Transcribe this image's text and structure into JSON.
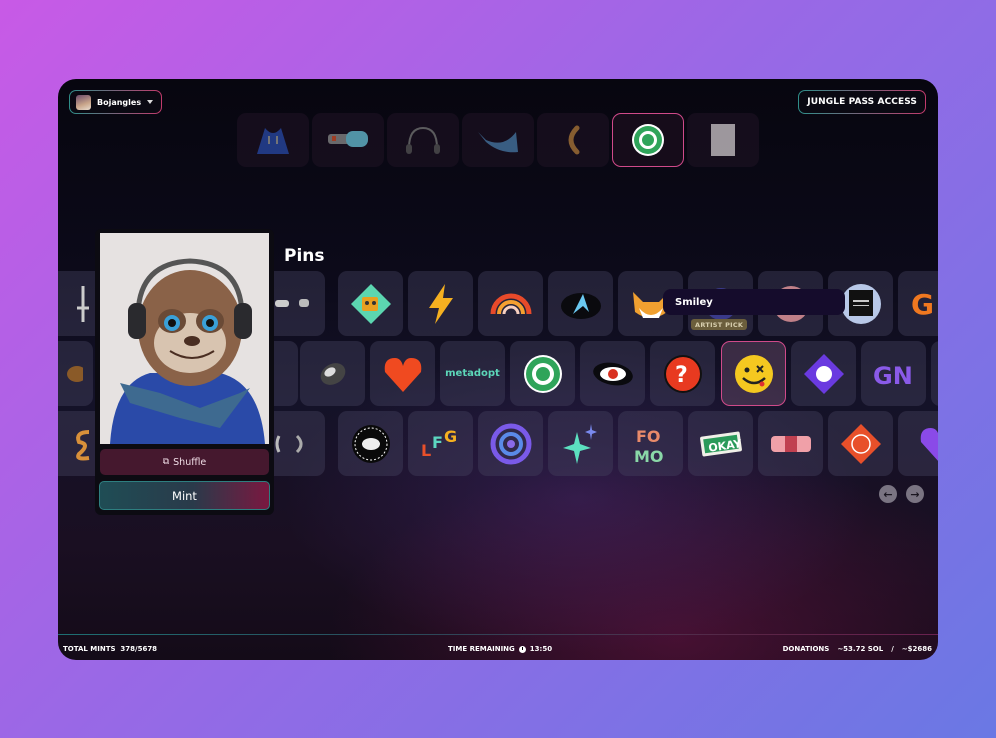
{
  "header": {
    "user_name": "Bojangles",
    "pass_button": "JUNGLE PASS ACCESS"
  },
  "traits": [
    {
      "name": "hoodie",
      "active": false
    },
    {
      "name": "goggles",
      "active": false
    },
    {
      "name": "headphones",
      "active": false
    },
    {
      "name": "bandana",
      "active": false
    },
    {
      "name": "earring",
      "active": false
    },
    {
      "name": "sloth-conservation-pin",
      "active": true
    },
    {
      "name": "background",
      "active": false
    }
  ],
  "pins": {
    "title": "Pins",
    "tooltip": "Smiley",
    "artist_pick_label": "ARTIST PICK",
    "rows": [
      [
        "cross-necklace",
        "hidden",
        "hidden",
        "silver-studs",
        "coffee-mug",
        "lightning",
        "rainbow",
        "arrow-badge",
        "fox",
        "blue-orb",
        "pink-orb",
        "pixel-face",
        "gm-text"
      ],
      [
        "gold-ring",
        "hidden",
        "hidden",
        "gold-hoop",
        "silver-stone",
        "heart",
        "metadopt",
        "sloth-conservation",
        "eye",
        "question-mark",
        "smiley",
        "purple-diamond",
        "gn-text",
        "edge"
      ],
      [
        "gold-swirl",
        "hidden",
        "hidden",
        "silver-hoops",
        "catalina-whale-mixer",
        "lfg",
        "spiral",
        "sparkles",
        "fomo",
        "okay",
        "bandage",
        "orange-diamond",
        "purple-heart"
      ]
    ],
    "metadopt_text": "metadopt",
    "selected": "smiley",
    "prev_label": "←",
    "next_label": "→"
  },
  "preview": {
    "shuffle_label": "Shuffle",
    "mint_label": "Mint"
  },
  "footer": {
    "total_mints_label": "TOTAL MINTS",
    "total_mints_value": "378/5678",
    "time_label": "TIME REMAINING",
    "time_value": "13:50",
    "donations_label": "DONATIONS",
    "donations_sol": "~53.72 SOL",
    "donations_sep": "/",
    "donations_usd": "~$2686"
  },
  "colors": {
    "accent_pink": "#d04a8a",
    "accent_teal": "#2f8f8a",
    "shuffle_bg": "#45182e"
  }
}
